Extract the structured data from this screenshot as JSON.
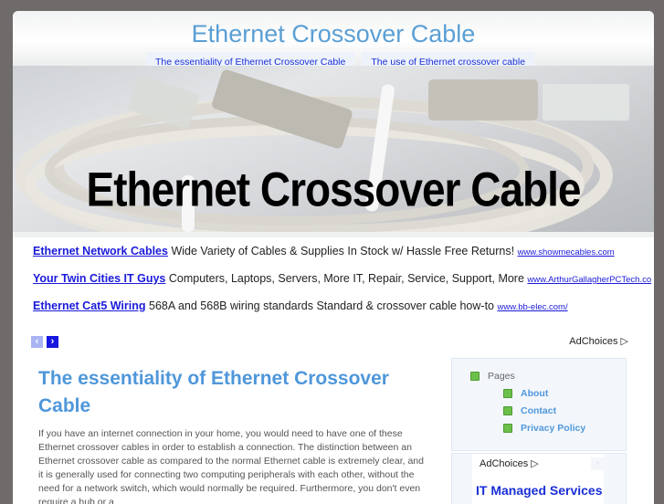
{
  "site": {
    "title": "Ethernet Crossover Cable",
    "nav": [
      {
        "label": "The essentiality of Ethernet Crossover Cable"
      },
      {
        "label": "The use of Ethernet crossover cable"
      }
    ]
  },
  "banner": {
    "title": "Ethernet Crossover Cable"
  },
  "ads": {
    "rows": [
      {
        "title": "Ethernet Network Cables",
        "text": "Wide Variety of Cables & Supplies In Stock w/ Hassle Free Returns!",
        "url": "www.showmecables.com"
      },
      {
        "title": "Your Twin Cities IT Guys",
        "text": "Computers, Laptops, Servers, More IT, Repair, Service, Support, More",
        "url": "www.ArthurGallagherPCTech.co"
      },
      {
        "title": "Ethernet Cat5 Wiring",
        "text": "568A and 568B wiring standards Standard & crossover cable how-to",
        "url": "www.bb-elec.com/"
      }
    ],
    "prev_icon": "‹",
    "next_icon": "›",
    "adchoices_label": "AdChoices",
    "adchoices_icon": "▷",
    "prev_color": "#a9b4f5",
    "next_color": "#1616e0"
  },
  "article": {
    "title": "The essentiality of Ethernet Crossover Cable",
    "body": "If you have an internet connection in your home, you would need to have one of these Ethernet crossover cables in order to establish a connection. The distinction between an Ethernet crossover cable as compared to the normal Ethernet cable is extremely clear, and it is generally used for connecting two computing peripherals with each other, without the need for a network switch, which would normally be required. Furthermore, you don't even require a hub or a"
  },
  "sidebar": {
    "pages_label": "Pages",
    "pages": [
      {
        "label": "About"
      },
      {
        "label": "Contact"
      },
      {
        "label": "Privacy Policy"
      }
    ],
    "ad": {
      "adchoices_label": "AdChoices",
      "adchoices_icon": "▷",
      "next_icon": "›",
      "headline": "IT Managed Services"
    }
  },
  "colors": {
    "accent": "#4f97da",
    "link": "#1a2fd6",
    "bullet": "#6cc04a",
    "frame": "#6e6b6a"
  }
}
